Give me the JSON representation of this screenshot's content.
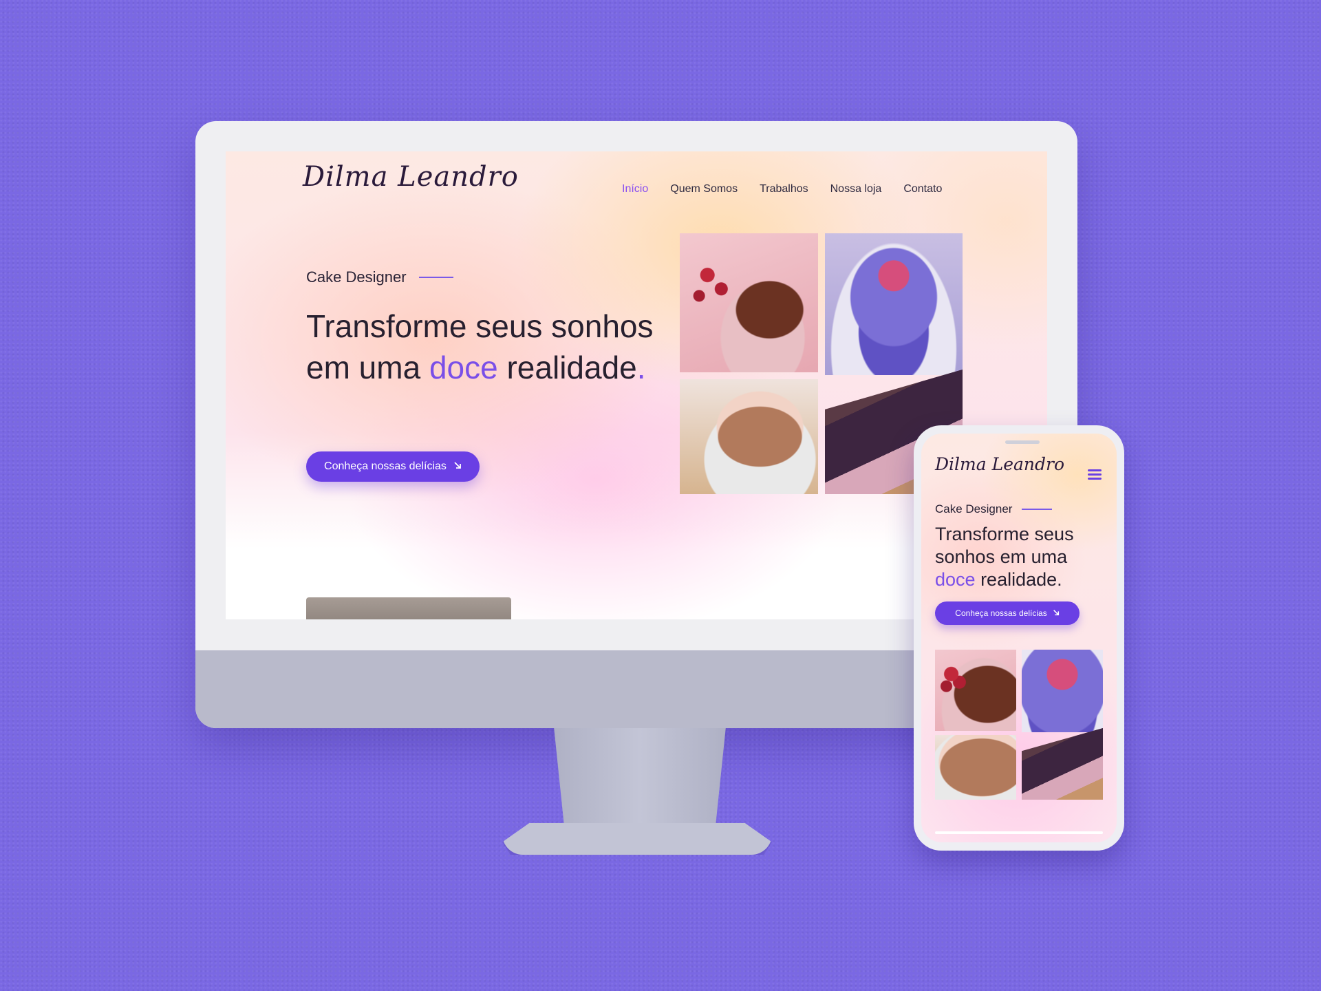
{
  "brand": {
    "logo_text": "Dilma Leandro"
  },
  "desktop": {
    "nav": [
      {
        "label": "Início",
        "active": true
      },
      {
        "label": "Quem Somos"
      },
      {
        "label": "Trabalhos"
      },
      {
        "label": "Nossa loja"
      },
      {
        "label": "Contato"
      }
    ],
    "hero": {
      "eyebrow": "Cake Designer",
      "headline_before": "Transforme seus sonhos em uma ",
      "headline_accent": "doce",
      "headline_after": " realidade",
      "headline_period": ".",
      "cta_label": "Conheça nossas delícias",
      "cta_icon": "arrow-down-right-icon"
    }
  },
  "mobile": {
    "menu_icon": "hamburger-menu-icon",
    "hero": {
      "eyebrow": "Cake Designer",
      "headline_before": "Transforme seus sonhos em uma ",
      "headline_accent": "doce",
      "headline_after": " realidade.",
      "cta_label": "Conheça nossas delícias",
      "cta_icon": "arrow-down-right-icon"
    }
  },
  "colors": {
    "background": "#7a68e3",
    "accent": "#7a4fe8",
    "button": "#6a3fe4",
    "text": "#27202f"
  }
}
